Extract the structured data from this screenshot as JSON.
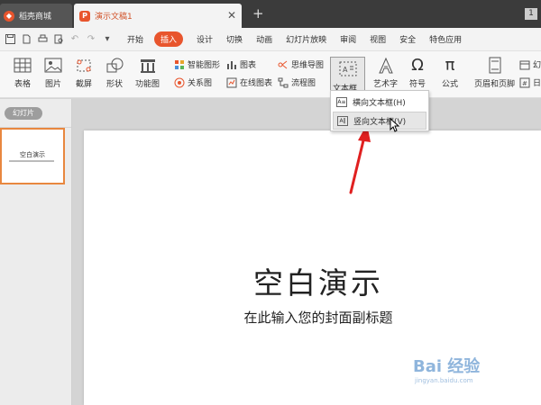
{
  "tabs": {
    "store_label": "稻壳商城",
    "doc_label": "演示文稿1",
    "close_glyph": "✕",
    "new_tab_glyph": "+",
    "window_badge": "1"
  },
  "menu": {
    "items": [
      "开始",
      "插入",
      "设计",
      "切换",
      "动画",
      "幻灯片放映",
      "审阅",
      "视图",
      "安全",
      "特色应用"
    ],
    "active": "插入",
    "active_color": "#e8552d"
  },
  "ribbon": {
    "table": "表格",
    "picture": "图片",
    "screenshot": "截屏",
    "shape": "形状",
    "function_chart": "功能图",
    "smart_graphic": "智能图形",
    "chart": "图表",
    "relation_chart": "关系图",
    "online_chart": "在线图表",
    "mind_map": "思维导图",
    "flow_chart": "流程图",
    "textbox": "文本框",
    "art_text": "艺术字",
    "symbol": "符号",
    "formula": "公式",
    "header_footer": "页眉和页脚",
    "date_partial": "幻",
    "date_partial2": "日"
  },
  "dropdown": {
    "horizontal": "横向文本框(H)",
    "vertical": "竖向文本框(V)"
  },
  "left_panel": {
    "tab_label": "幻灯片",
    "thumb_title": "空白演示"
  },
  "slide": {
    "title": "空白演示",
    "subtitle": "在此输入您的封面副标题"
  },
  "watermark": {
    "main": "Bai 经验",
    "sub": "jingyan.baidu.com"
  },
  "colors": {
    "accent": "#e8552d",
    "annotation_arrow": "#e02020",
    "thumb_border": "#e8873f"
  },
  "icons": [
    "save-icon",
    "export-pdf-icon",
    "print-icon",
    "print-preview-icon",
    "undo-icon",
    "redo-icon",
    "customize-icon",
    "table-icon",
    "picture-icon",
    "screenshot-icon",
    "shape-icon",
    "function-chart-icon",
    "textbox-icon",
    "art-text-icon",
    "omega-icon",
    "pi-icon",
    "header-footer-icon"
  ]
}
